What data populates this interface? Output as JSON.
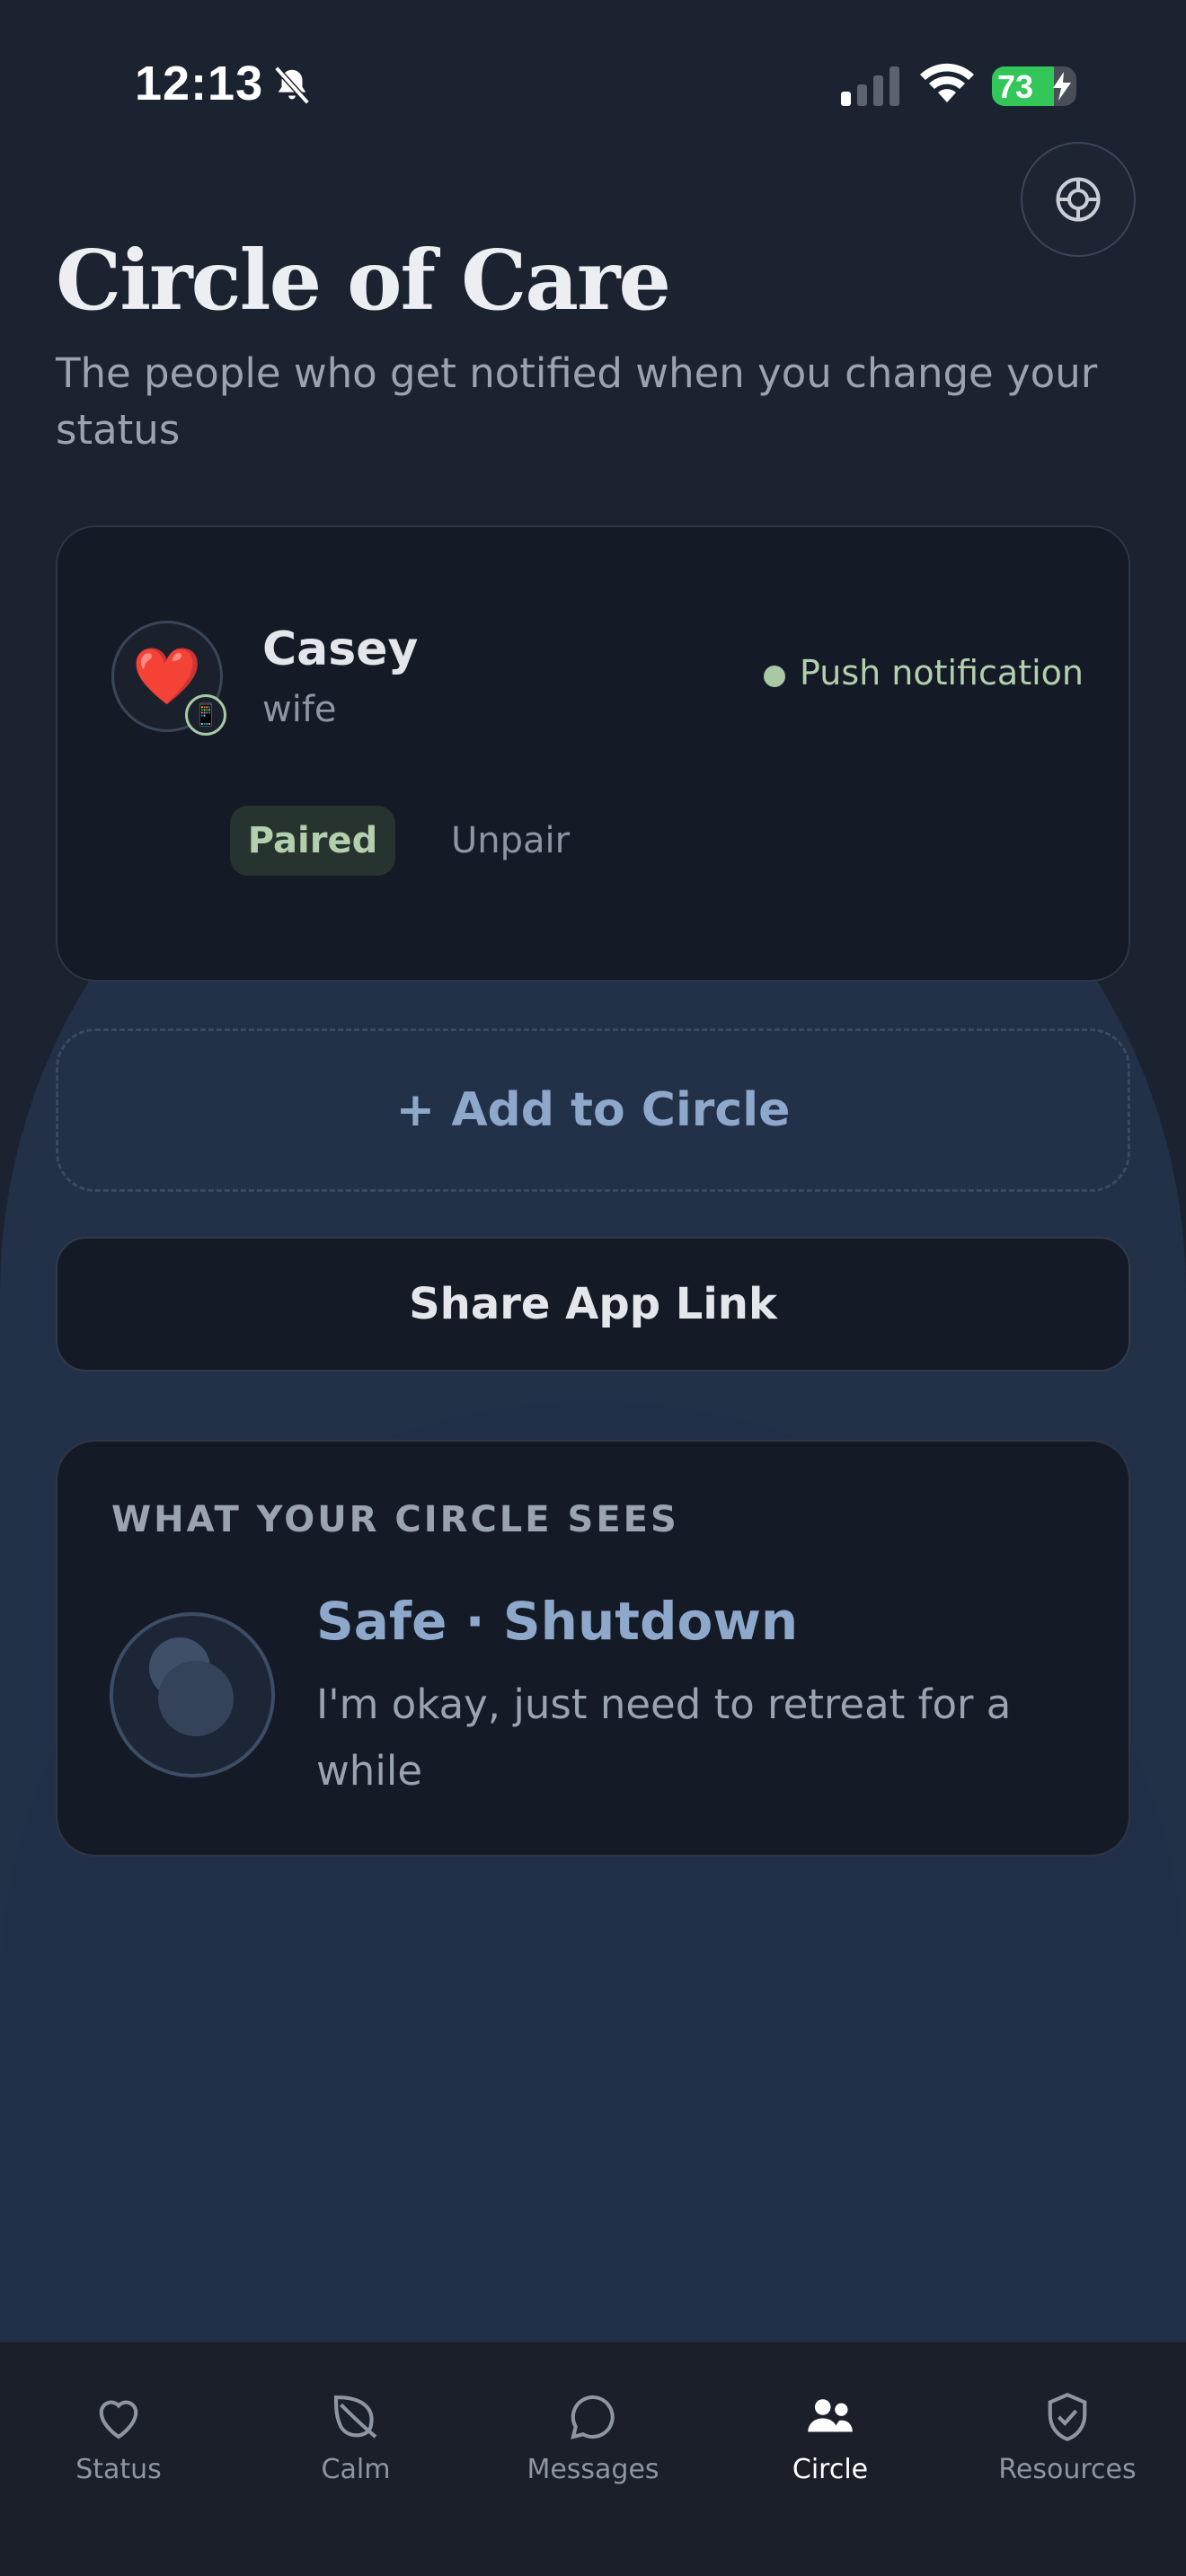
{
  "status_bar": {
    "time": "12:13",
    "battery": "73",
    "battery_level": 0.73,
    "icons": [
      "bell-slash-icon",
      "signal-icon",
      "wifi-icon",
      "battery-charging-icon"
    ]
  },
  "header": {
    "title": "Circle of Care",
    "subtitle": "The people who get notified when you change your status",
    "globe_icon": "globe-icon"
  },
  "contact": {
    "name": "Casey",
    "relation": "wife",
    "avatar_emoji": "❤️",
    "device_emoji": "📱",
    "channel": "Push notification",
    "paired_label": "Paired",
    "unpair_label": "Unpair"
  },
  "actions": {
    "add_label": "+ Add to Circle",
    "share_label": "Share App Link"
  },
  "preview": {
    "heading": "WHAT YOUR CIRCLE SEES",
    "status_title": "Safe · Shutdown",
    "status_desc": "I'm okay, just need to retreat for a while",
    "icon": "moon-icon"
  },
  "tabs": [
    {
      "label": "Status",
      "icon": "heart-icon",
      "active": false
    },
    {
      "label": "Calm",
      "icon": "leaf-icon",
      "active": false
    },
    {
      "label": "Messages",
      "icon": "chat-bubble-icon",
      "active": false
    },
    {
      "label": "Circle",
      "icon": "people-icon",
      "active": true
    },
    {
      "label": "Resources",
      "icon": "shield-check-icon",
      "active": false
    }
  ],
  "colors": {
    "background": "#1b2331",
    "card": "#151b26",
    "accent_green": "#b3d0ae",
    "accent_blue": "#8ea8cb",
    "battery_green": "#33c759"
  }
}
